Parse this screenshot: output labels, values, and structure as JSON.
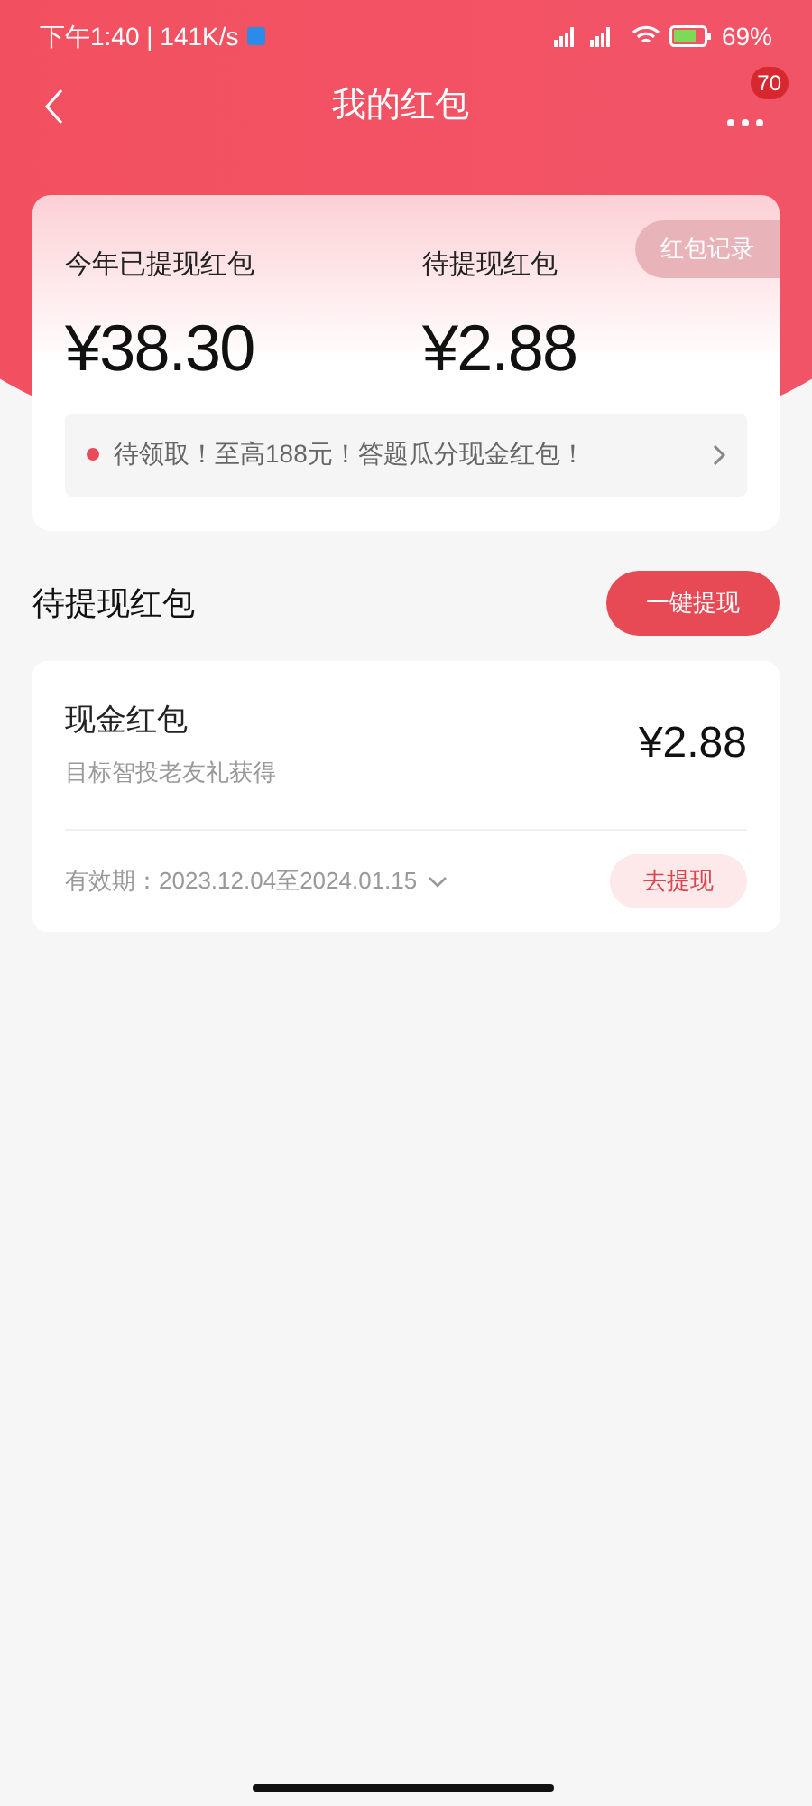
{
  "status_bar": {
    "time": "下午1:40 | 141K/s",
    "battery": "69%"
  },
  "nav": {
    "title": "我的红包",
    "badge": "70"
  },
  "summary": {
    "record_button": "红包记录",
    "stats": [
      {
        "label": "今年已提现红包",
        "amount": "¥38.30"
      },
      {
        "label": "待提现红包",
        "amount": "¥2.88"
      }
    ],
    "banner": "待领取！至高188元！答题瓜分现金红包！"
  },
  "section": {
    "title": "待提现红包",
    "button": "一键提现"
  },
  "items": [
    {
      "title": "现金红包",
      "subtitle": "目标智投老友礼获得",
      "amount": "¥2.88",
      "validity": "有效期：2023.12.04至2024.01.15",
      "button": "去提现"
    }
  ]
}
